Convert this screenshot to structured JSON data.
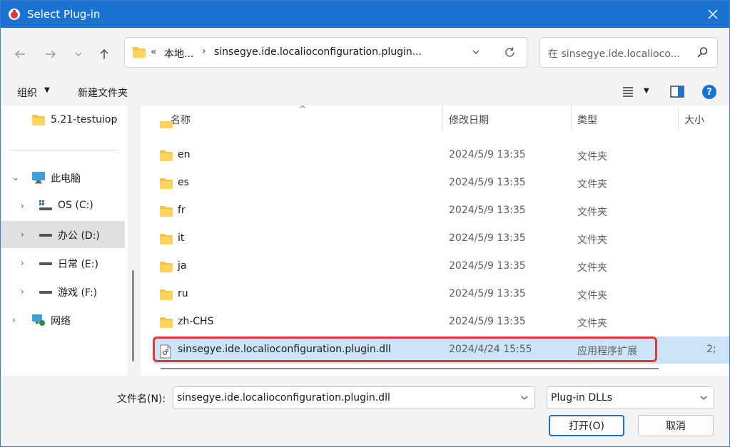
{
  "window": {
    "title": "Select Plug-in"
  },
  "address": {
    "overflow": "«",
    "crumbs": [
      "本地...",
      "sinsegye.ide.localioconfiguration.plugin..."
    ]
  },
  "search": {
    "placeholder": "在 sinsegye.ide.localioco..."
  },
  "toolbar": {
    "organize_label": "组织",
    "new_folder_label": "新建文件夹"
  },
  "sidebar": {
    "items": [
      {
        "label": "5.21-testuiop"
      },
      {
        "label": "此电脑"
      },
      {
        "label": "OS (C:)"
      },
      {
        "label": "办公 (D:)"
      },
      {
        "label": "日常 (E:)"
      },
      {
        "label": "游戏 (F:)"
      },
      {
        "label": "网络"
      }
    ]
  },
  "columns": {
    "name": "名称",
    "date": "修改日期",
    "type": "类型",
    "size": "大小"
  },
  "rows": [
    {
      "name": "en",
      "date": "2024/5/9 13:35",
      "type": "文件夹",
      "size": ""
    },
    {
      "name": "es",
      "date": "2024/5/9 13:35",
      "type": "文件夹",
      "size": ""
    },
    {
      "name": "fr",
      "date": "2024/5/9 13:35",
      "type": "文件夹",
      "size": ""
    },
    {
      "name": "it",
      "date": "2024/5/9 13:35",
      "type": "文件夹",
      "size": ""
    },
    {
      "name": "ja",
      "date": "2024/5/9 13:35",
      "type": "文件夹",
      "size": ""
    },
    {
      "name": "ru",
      "date": "2024/5/9 13:35",
      "type": "文件夹",
      "size": ""
    },
    {
      "name": "zh-CHS",
      "date": "2024/5/9 13:35",
      "type": "文件夹",
      "size": ""
    },
    {
      "name": "sinsegye.ide.localioconfiguration.plugin.dll",
      "date": "2024/4/24 15:55",
      "type": "应用程序扩展",
      "size": "2;"
    }
  ],
  "footer": {
    "filename_label": "文件名(N):",
    "filename_value": "sinsegye.ide.localioconfiguration.plugin.dll",
    "filetype_value": "Plug-in DLLs",
    "open_label": "打开(O)",
    "cancel_label": "取消"
  },
  "colors": {
    "accent": "#1a73d1",
    "selection": "#cce4f7",
    "highlight_outline": "#e0383c",
    "folder": "#f4c542"
  }
}
